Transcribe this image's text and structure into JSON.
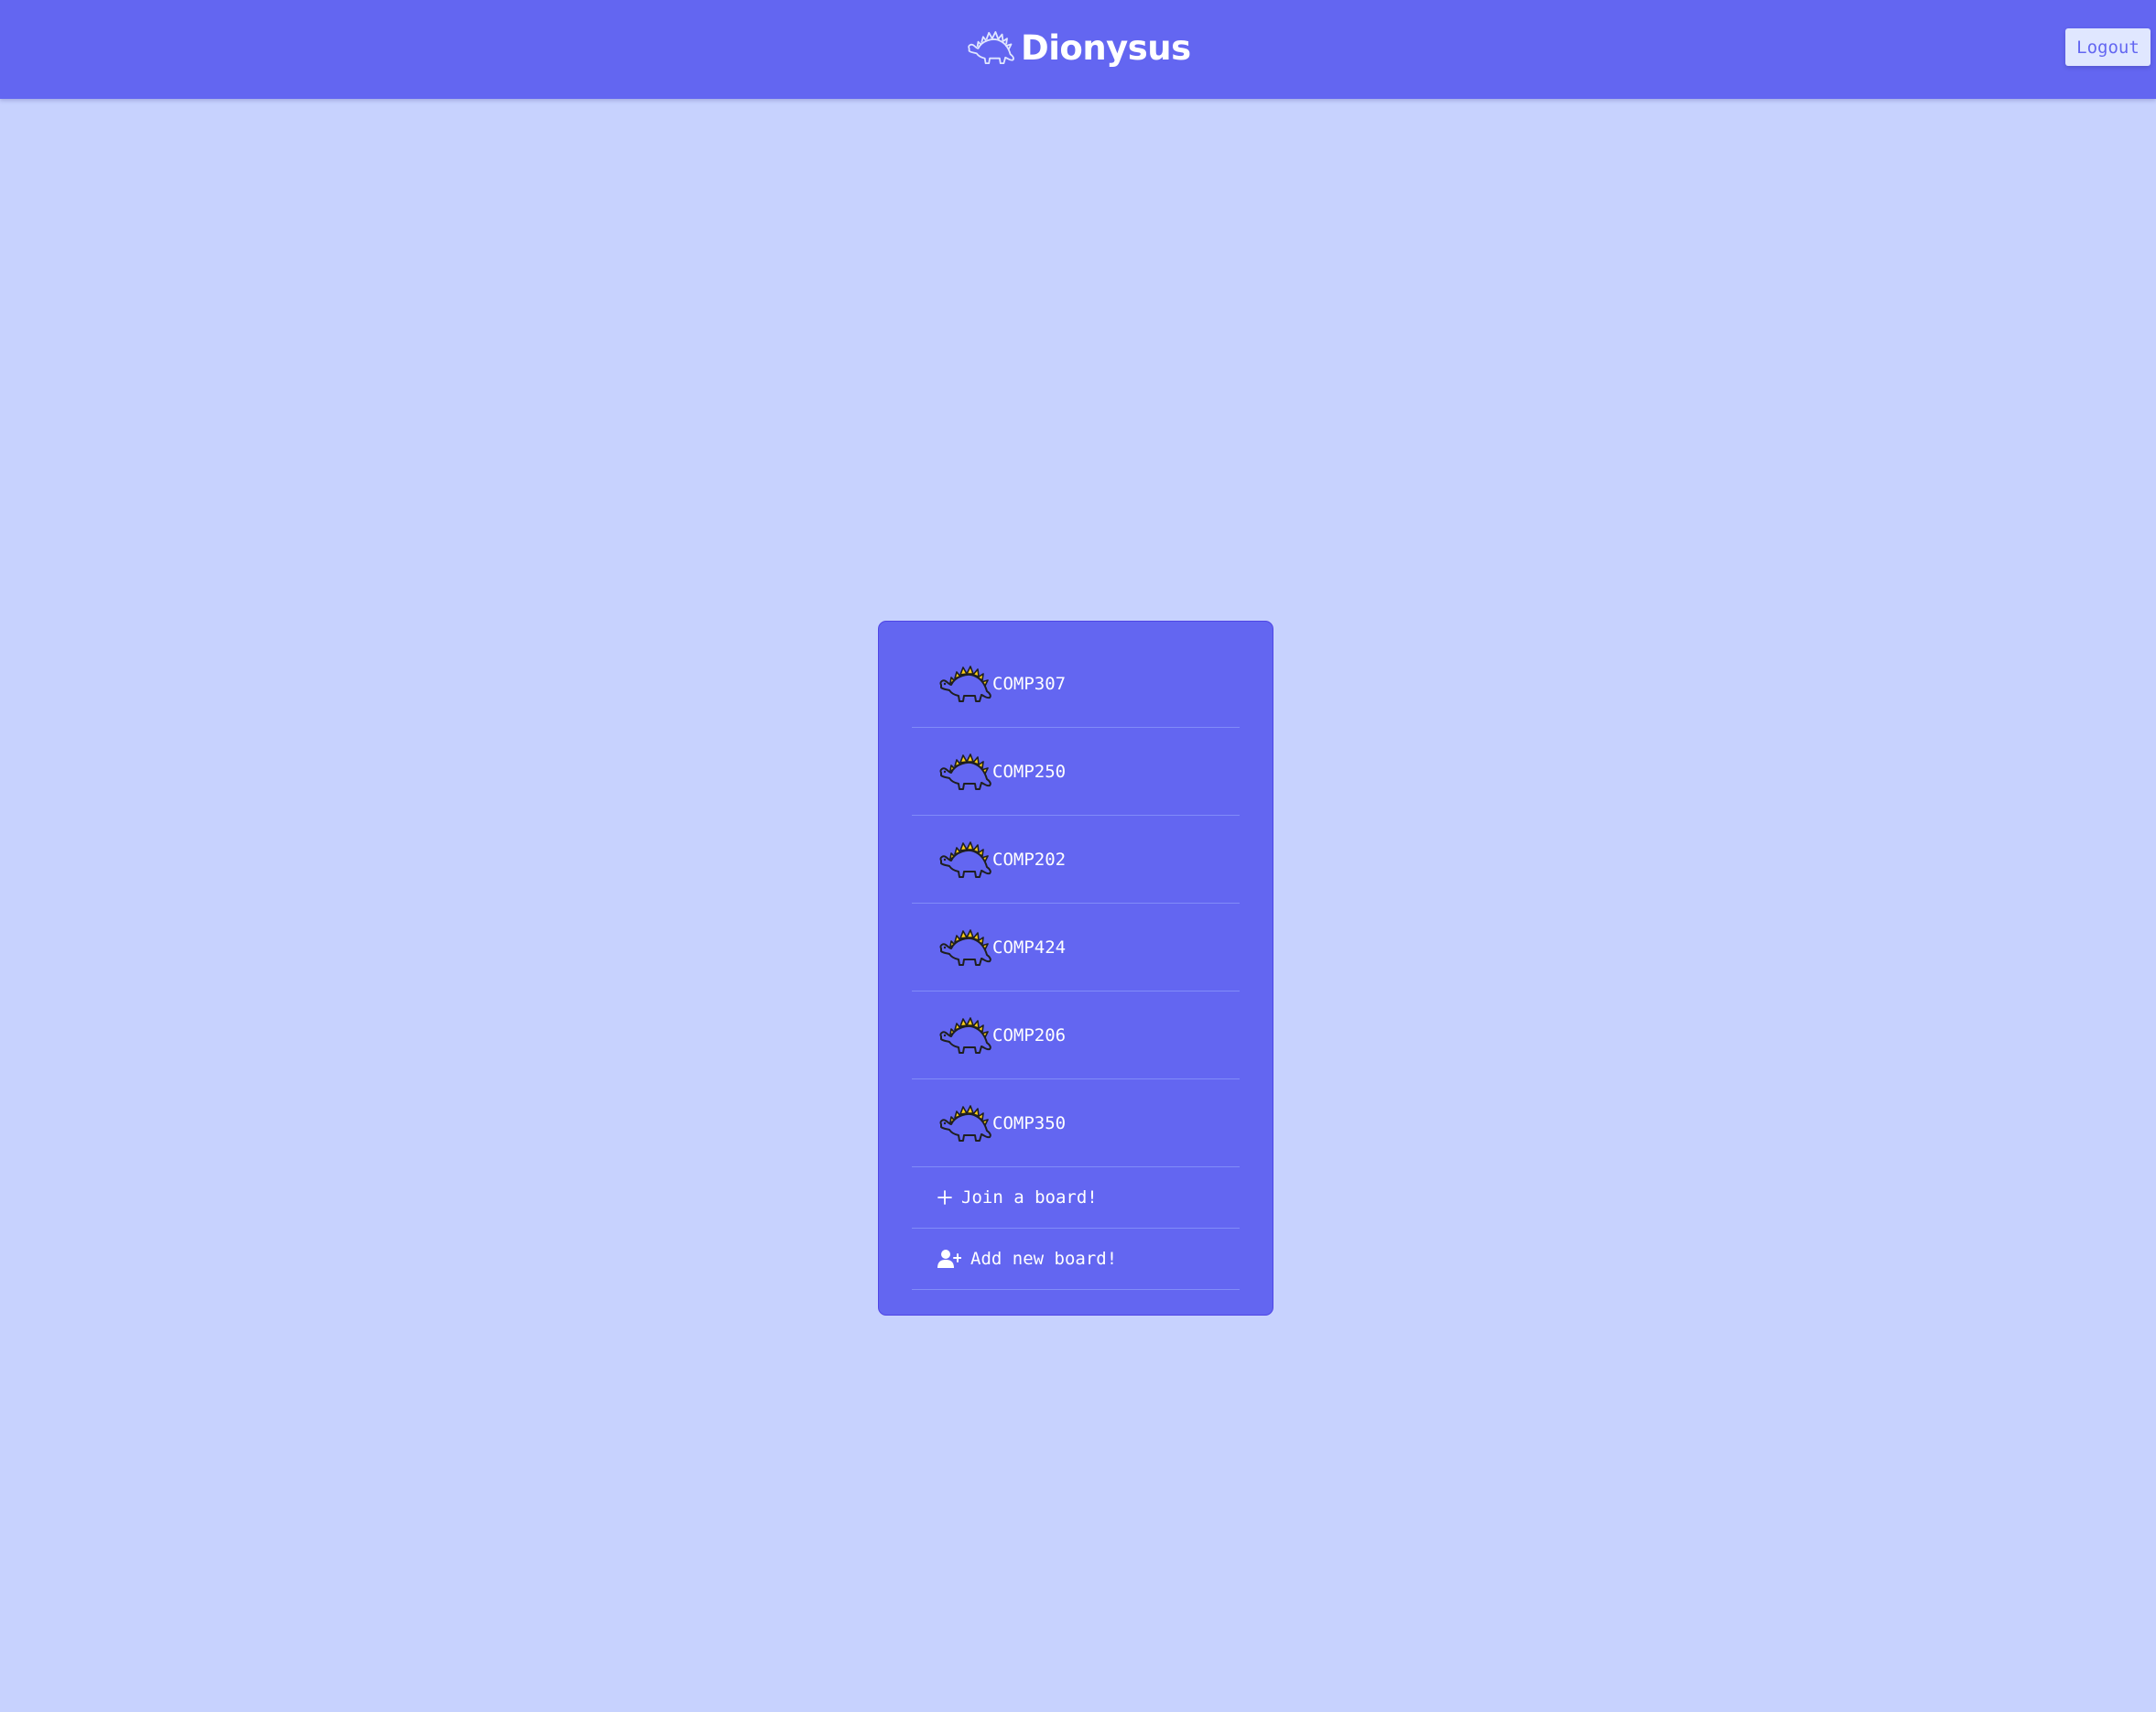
{
  "header": {
    "brand_name": "Dionysus",
    "logo_icon": "stegosaurus-outline-icon",
    "logout_label": "Logout"
  },
  "boards": {
    "icon": "stegosaurus-icon",
    "items": [
      {
        "label": "COMP307"
      },
      {
        "label": "COMP250"
      },
      {
        "label": "COMP202"
      },
      {
        "label": "COMP424"
      },
      {
        "label": "COMP206"
      },
      {
        "label": "COMP350"
      }
    ]
  },
  "actions": {
    "join": {
      "label": "Join a board!",
      "icon": "plus-icon"
    },
    "add": {
      "label": "Add new board!",
      "icon": "user-plus-icon"
    }
  },
  "colors": {
    "page_background": "#c7d2fe",
    "header_background": "#6366f1",
    "panel_background": "#6366f1",
    "logout_background": "#e0e7ff",
    "logout_text": "#6366f1",
    "dino_body": "#6366f1",
    "dino_plates": "#facc15"
  }
}
